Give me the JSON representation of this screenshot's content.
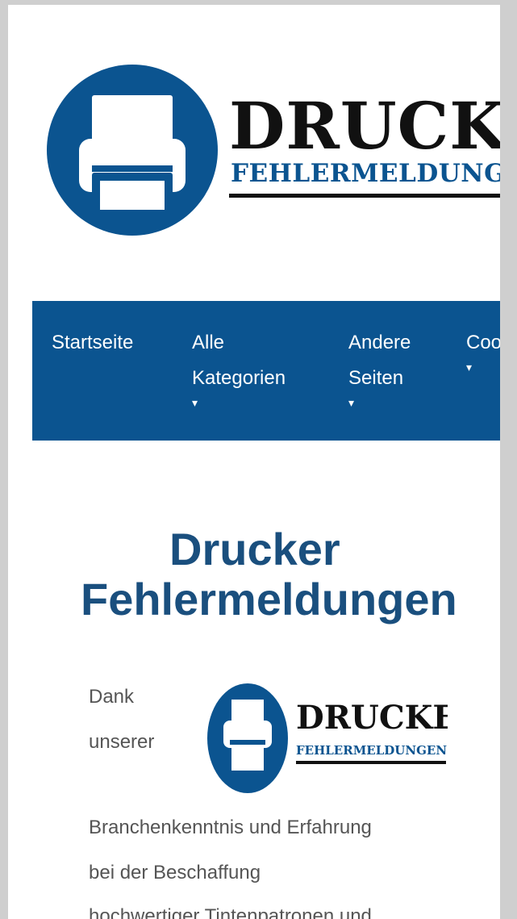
{
  "logo": {
    "word1": "DRUCKER",
    "word2": "FEHLERMELDUNGEN"
  },
  "nav": {
    "items": [
      {
        "line1": "Startseite",
        "line2": "",
        "caret": ""
      },
      {
        "line1": "Alle",
        "line2": "Kategorien",
        "caret": "▾"
      },
      {
        "line1": "Andere",
        "line2": "Seiten",
        "caret": "▾"
      },
      {
        "line1": "Cookies",
        "line2": "",
        "caret": "▾"
      }
    ]
  },
  "main": {
    "title_line1": "Drucker",
    "title_line2": "Fehlermeldungen",
    "intro_word1": "Dank",
    "intro_word2": "unserer",
    "para_line1": "Branchenkenntnis und Erfahrung",
    "para_line2": "bei der Beschaffung",
    "para_line3": "hochwertiger Tintenpatronen und"
  },
  "colors": {
    "brand_blue": "#0b5490",
    "title_blue": "#1a4f7e",
    "text_gray": "#555555"
  }
}
